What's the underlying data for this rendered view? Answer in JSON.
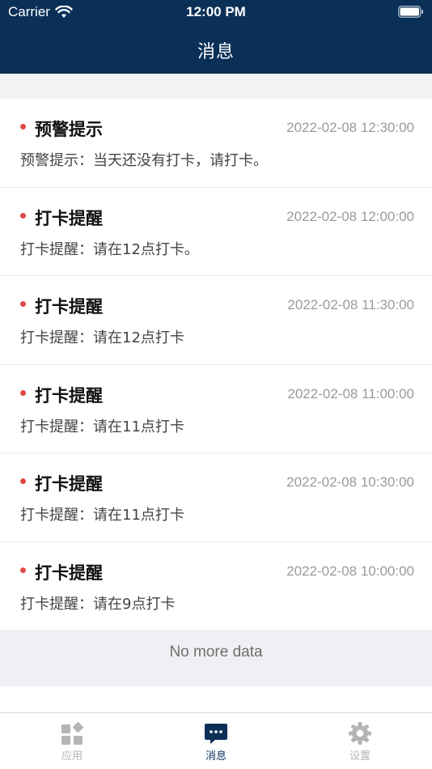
{
  "status_bar": {
    "carrier": "Carrier",
    "time": "12:00 PM"
  },
  "nav": {
    "title": "消息"
  },
  "messages": [
    {
      "title": "预警提示",
      "time": "2022-02-08 12:30:00",
      "body": "预警提示：当天还没有打卡，请打卡。"
    },
    {
      "title": "打卡提醒",
      "time": "2022-02-08 12:00:00",
      "body": "打卡提醒：请在12点打卡。"
    },
    {
      "title": "打卡提醒",
      "time": "2022-02-08 11:30:00",
      "body": "打卡提醒：请在12点打卡"
    },
    {
      "title": "打卡提醒",
      "time": "2022-02-08 11:00:00",
      "body": "打卡提醒：请在11点打卡"
    },
    {
      "title": "打卡提醒",
      "time": "2022-02-08 10:30:00",
      "body": "打卡提醒：请在11点打卡"
    },
    {
      "title": "打卡提醒",
      "time": "2022-02-08 10:00:00",
      "body": "打卡提醒：请在9点打卡"
    }
  ],
  "footer_text": "No more data",
  "tabs": [
    {
      "label": "应用",
      "icon": "apps-icon",
      "active": false
    },
    {
      "label": "消息",
      "icon": "message-icon",
      "active": true
    },
    {
      "label": "设置",
      "icon": "gear-icon",
      "active": false
    }
  ],
  "colors": {
    "header_bg": "#0b3058",
    "unread_dot": "#e04a4a",
    "tab_active": "#0b3058",
    "tab_inactive": "#b5b5b5"
  }
}
